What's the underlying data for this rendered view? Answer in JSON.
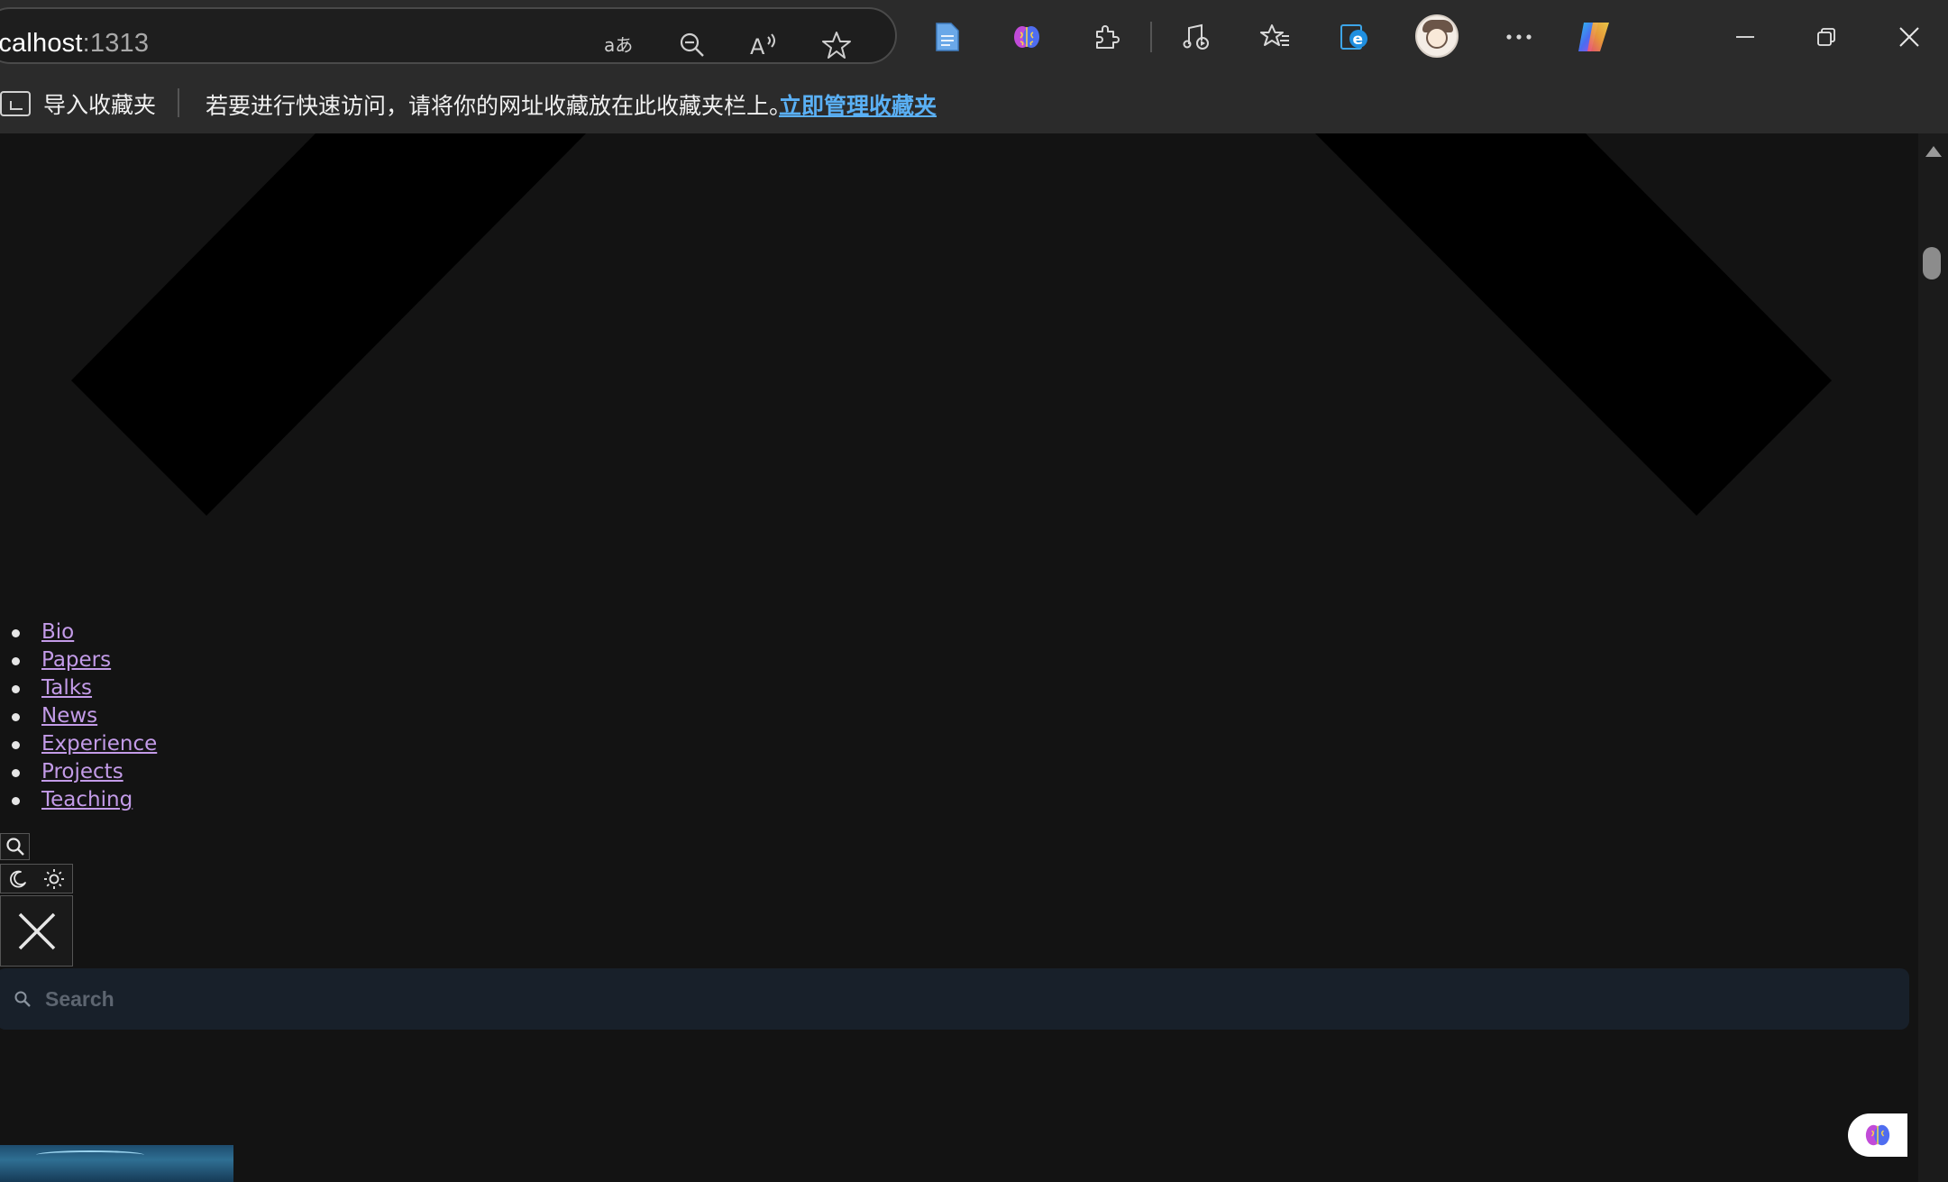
{
  "browser": {
    "url_host": "ocalhost",
    "url_port": ":1313",
    "address_icons": [
      "translate-icon",
      "zoom-out-icon",
      "read-aloud-icon",
      "favorite-star-icon"
    ],
    "toolbar_icons": [
      "document-icon",
      "brain-extension-icon",
      "extensions-icon",
      "media-icon",
      "favorites-icon",
      "ie-mode-icon",
      "profile-avatar",
      "more-icon",
      "copilot-icon"
    ],
    "window_controls": [
      "minimize-icon",
      "restore-icon",
      "close-icon"
    ]
  },
  "favorites_bar": {
    "import_label": "导入收藏夹",
    "message": "若要进行快速访问，请将你的网址收藏放在此收藏夹栏上。",
    "manage_link": "立即管理收藏夹"
  },
  "nav": {
    "items": [
      {
        "label": "Bio"
      },
      {
        "label": "Papers"
      },
      {
        "label": "Talks"
      },
      {
        "label": "News"
      },
      {
        "label": "Experience"
      },
      {
        "label": "Projects"
      },
      {
        "label": "Teaching"
      }
    ]
  },
  "search": {
    "placeholder": "Search"
  },
  "colors": {
    "page_background": "#131313",
    "chrome_background": "#2b2b2b",
    "nav_link": "#c39be8",
    "favorites_link": "#5ab0f5",
    "search_background": "#18202a"
  }
}
